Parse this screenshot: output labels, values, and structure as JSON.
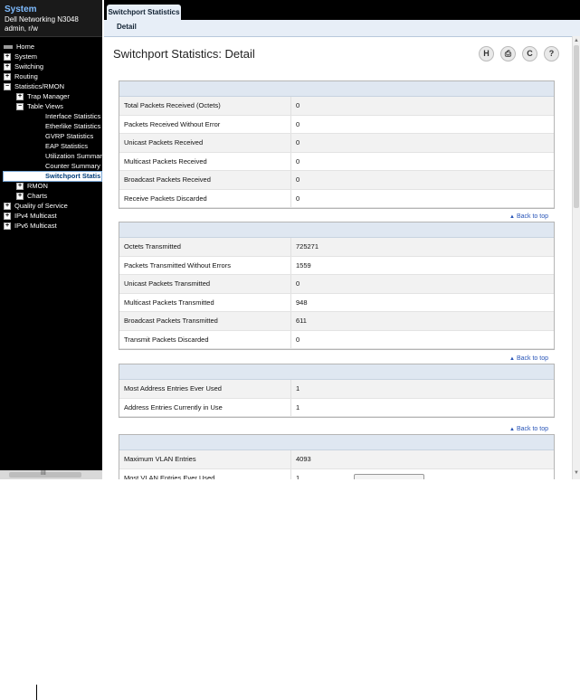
{
  "system": {
    "title": "System",
    "device": "Dell Networking N3048",
    "user": "admin, r/w"
  },
  "nav": {
    "home": "Home",
    "system": "System",
    "switching": "Switching",
    "routing": "Routing",
    "statistics_rmon": "Statistics/RMON",
    "trap_manager": "Trap Manager",
    "table_views": "Table Views",
    "interface_statistics": "Interface Statistics",
    "etherlike_statistics": "Etherlike Statistics",
    "gvrp_statistics": "GVRP Statistics",
    "eap_statistics": "EAP Statistics",
    "utilization_summary": "Utilization Summary",
    "counter_summary": "Counter Summary",
    "switchport_statistics": "Switchport Statis",
    "rmon": "RMON",
    "charts": "Charts",
    "quality_of_service": "Quality of Service",
    "ipv4_multicast": "IPv4 Multicast",
    "ipv6_multicast": "IPv6 Multicast",
    "expand": "+",
    "collapse": "−",
    "hscroll_label": "III"
  },
  "tabs": {
    "main": "Switchport Statistics",
    "detail": "Detail"
  },
  "page": {
    "title": "Switchport Statistics: Detail"
  },
  "toolbar": {
    "save": "H",
    "print": "⎙",
    "refresh": "C",
    "help": "?"
  },
  "back_to_top": "Back to top",
  "panels": {
    "received": [
      {
        "label": "Total Packets Received (Octets)",
        "value": "0"
      },
      {
        "label": "Packets Received Without Error",
        "value": "0"
      },
      {
        "label": "Unicast Packets Received",
        "value": "0"
      },
      {
        "label": "Multicast Packets Received",
        "value": "0"
      },
      {
        "label": "Broadcast Packets Received",
        "value": "0"
      },
      {
        "label": "Receive Packets Discarded",
        "value": "0"
      }
    ],
    "transmitted": [
      {
        "label": "Octets Transmitted",
        "value": "725271"
      },
      {
        "label": "Packets Transmitted Without Errors",
        "value": "1559"
      },
      {
        "label": "Unicast Packets Transmitted",
        "value": "0"
      },
      {
        "label": "Multicast Packets Transmitted",
        "value": "948"
      },
      {
        "label": "Broadcast Packets Transmitted",
        "value": "611"
      },
      {
        "label": "Transmit Packets Discarded",
        "value": "0"
      }
    ],
    "address": [
      {
        "label": "Most Address Entries Ever Used",
        "value": "1"
      },
      {
        "label": "Address Entries Currently in Use",
        "value": "1"
      }
    ],
    "vlan": [
      {
        "label": "Maximum VLAN Entries",
        "value": "4093"
      },
      {
        "label": "Most VLAN Entries Ever Used",
        "value": "1"
      }
    ]
  }
}
